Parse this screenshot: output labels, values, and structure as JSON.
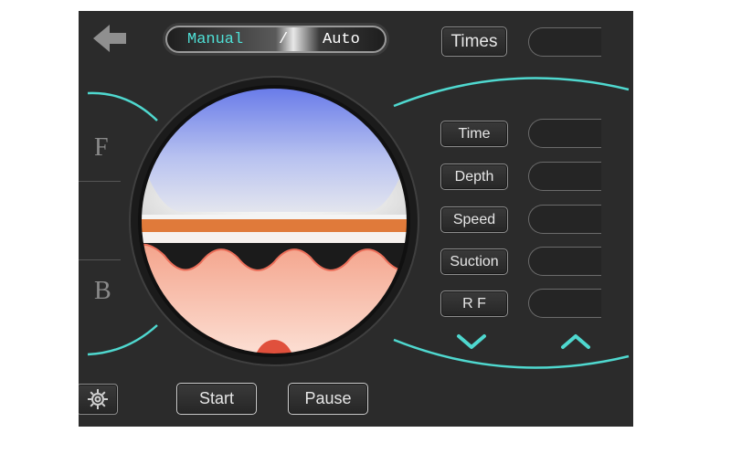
{
  "mode": {
    "manual": "Manual",
    "separator": "/",
    "auto": "Auto",
    "selected": "manual"
  },
  "header": {
    "times_label": "Times"
  },
  "params": [
    {
      "key": "time",
      "label": "Time"
    },
    {
      "key": "depth",
      "label": "Depth"
    },
    {
      "key": "speed",
      "label": "Speed"
    },
    {
      "key": "suction",
      "label": "Suction"
    },
    {
      "key": "rf",
      "label": "R F"
    }
  ],
  "side": {
    "front_label": "F",
    "back_label": "B"
  },
  "controls": {
    "start_label": "Start",
    "pause_label": "Pause"
  },
  "icons": {
    "back": "back-arrow-icon",
    "settings": "gear-icon",
    "down": "chevron-down-icon",
    "up": "chevron-up-icon"
  },
  "colors": {
    "accent": "#4fd8cf",
    "background": "#2b2b2b",
    "manual_text": "#4fe0d6"
  }
}
